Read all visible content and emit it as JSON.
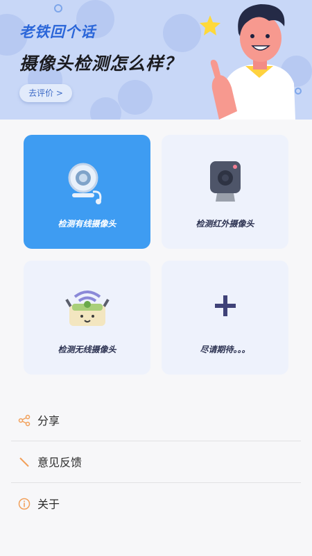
{
  "banner": {
    "title": "老铁回个话",
    "headline": "摄像头检测怎么样？",
    "rate_button": "去评价 >"
  },
  "cards": [
    {
      "label": "检测有线摄像头",
      "icon": "webcam-icon",
      "selected": true
    },
    {
      "label": "检测红外摄像头",
      "icon": "camera-icon",
      "selected": false
    },
    {
      "label": "检测无线摄像头",
      "icon": "wifi-robot-icon",
      "selected": false
    },
    {
      "label": "尽请期待。。。",
      "icon": "plus-icon",
      "selected": false
    }
  ],
  "menu": [
    {
      "label": "分享",
      "icon": "share-icon"
    },
    {
      "label": "意见反馈",
      "icon": "pencil-icon"
    },
    {
      "label": "关于",
      "icon": "info-icon"
    }
  ],
  "colors": {
    "accent": "#3e9cf2",
    "banner_bg": "#c8d7f7",
    "title_blue": "#2b66d9",
    "menu_icon": "#f2a05a"
  }
}
